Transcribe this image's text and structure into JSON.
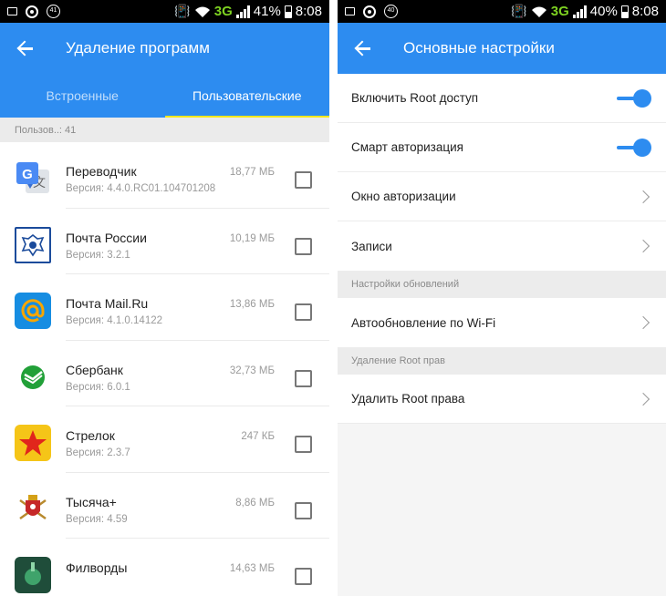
{
  "left": {
    "status": {
      "battery": "41%",
      "time": "8:08",
      "network": "3G",
      "badge": "41"
    },
    "title": "Удаление программ",
    "tabs": [
      {
        "label": "Встроенные",
        "active": false
      },
      {
        "label": "Пользовательские",
        "active": true
      }
    ],
    "count_label": "Пользов..: 41",
    "apps": [
      {
        "name": "Переводчик",
        "version": "Версия: 4.4.0.RC01.104701208",
        "size": "18,77 МБ",
        "icon": "google-translate-icon"
      },
      {
        "name": "Почта России",
        "version": "Версия: 3.2.1",
        "size": "10,19 МБ",
        "icon": "russian-post-icon"
      },
      {
        "name": "Почта Mail.Ru",
        "version": "Версия: 4.1.0.14122",
        "size": "13,86 МБ",
        "icon": "mail-ru-icon"
      },
      {
        "name": "Сбербанк",
        "version": "Версия: 6.0.1",
        "size": "32,73 МБ",
        "icon": "sberbank-icon"
      },
      {
        "name": "Стрелок",
        "version": "Версия: 2.3.7",
        "size": "247 КБ",
        "icon": "strelok-star-icon"
      },
      {
        "name": "Тысяча+",
        "version": "Версия: 4.59",
        "size": "8,86 МБ",
        "icon": "thousand-plus-crest-icon"
      },
      {
        "name": "Филворды",
        "version": "",
        "size": "14,63 МБ",
        "icon": "filwords-icon"
      }
    ]
  },
  "right": {
    "status": {
      "battery": "40%",
      "time": "8:08",
      "network": "3G",
      "badge": "40"
    },
    "title": "Основные настройки",
    "rows_top": [
      {
        "label": "Включить Root доступ",
        "control": "switch",
        "on": true
      },
      {
        "label": "Смарт авторизация",
        "control": "switch",
        "on": true
      },
      {
        "label": "Окно авторизации",
        "control": "chevron"
      },
      {
        "label": "Записи",
        "control": "chevron"
      }
    ],
    "section_updates": "Настройки обновлений",
    "row_wifi": {
      "label": "Автообновление по Wi-Fi"
    },
    "section_remove": "Удаление Root прав",
    "row_remove": {
      "label": "Удалить Root права"
    }
  },
  "colors": {
    "accent": "#2d8cf0",
    "tab_indicator": "#f8e71c",
    "network": "#7ed321"
  }
}
